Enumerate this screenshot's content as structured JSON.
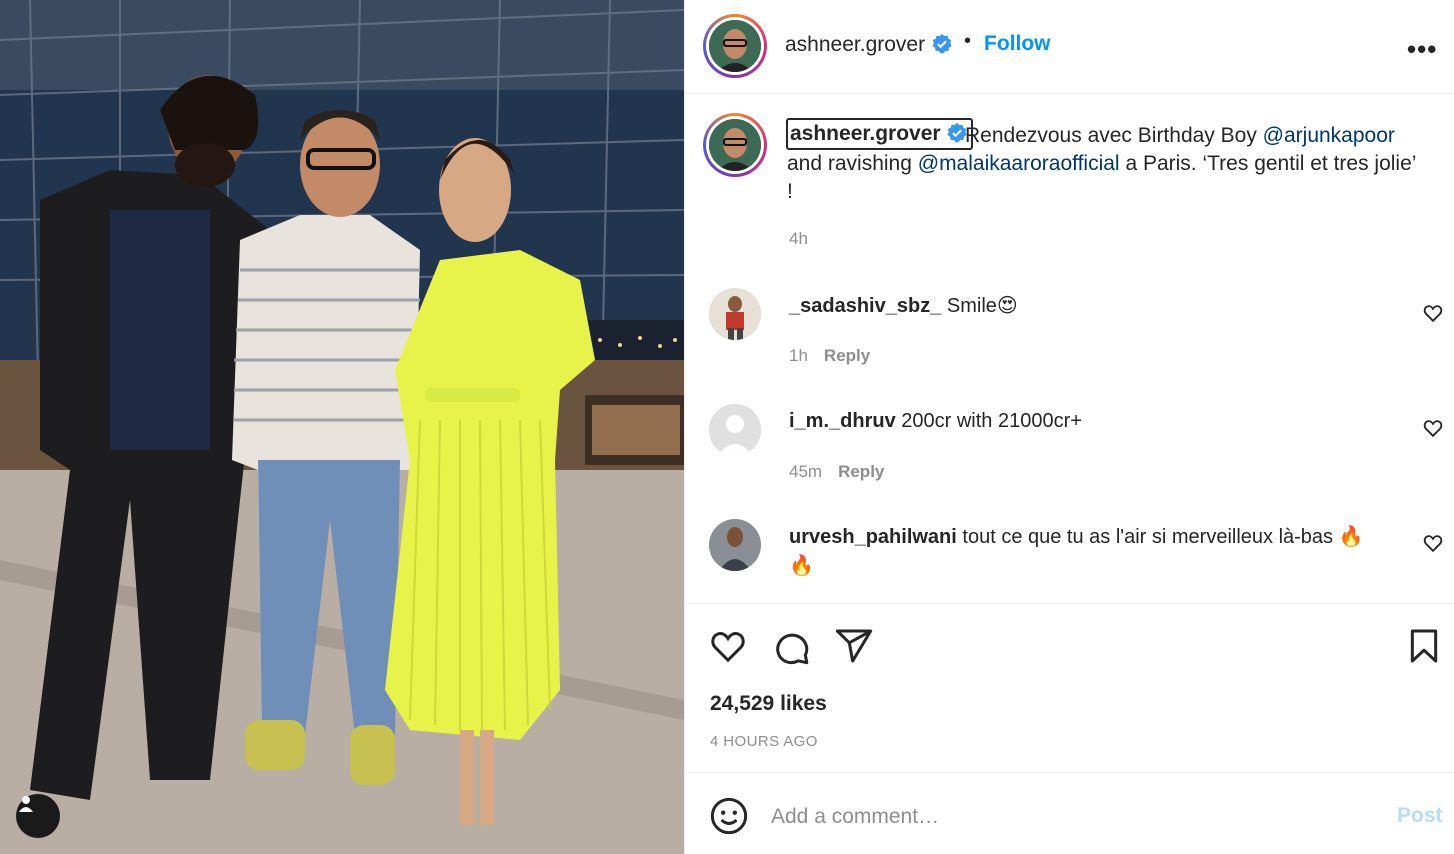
{
  "post": {
    "username": "ashneer.grover",
    "verified": true,
    "dot_separator": "•",
    "follow_label": "Follow",
    "more_label": "•••"
  },
  "caption": {
    "username": "ashneer.grover",
    "part1": "Rendezvous avec Birthday Boy ",
    "mention1": "@arjunkapoor",
    "part2": " and ravishing ",
    "mention2": "@malaikaaroraofficial",
    "part3": " a Paris. ‘Tres gentil et tres jolie’ !",
    "time": "4h"
  },
  "comments": [
    {
      "username": "_sadashiv_sbz_",
      "text": " Smile",
      "emoji": "😍",
      "time": "1h",
      "reply_label": "Reply"
    },
    {
      "username": "i_m._dhruv",
      "text": " 200cr with 21000cr+",
      "emoji": "",
      "time": "45m",
      "reply_label": "Reply"
    },
    {
      "username": "urvesh_pahilwani",
      "text": " tout ce que tu as l'air si merveilleux là-bas ",
      "emoji": "🔥",
      "emoji2": "🔥"
    }
  ],
  "engagement": {
    "likes": "24,529 likes",
    "posted": "4 HOURS AGO"
  },
  "add_comment": {
    "placeholder": "Add a comment…",
    "post_label": "Post"
  },
  "colors": {
    "link": "#0095f6",
    "mention": "#00376b",
    "muted": "#8e8e8e",
    "post_disabled": "#b2dffc",
    "dress": "#e8f34a"
  },
  "icons": [
    "user-tag-icon",
    "verified-badge-icon",
    "more-options-icon",
    "heart-icon",
    "comment-icon",
    "share-icon",
    "bookmark-icon",
    "emoji-icon"
  ]
}
